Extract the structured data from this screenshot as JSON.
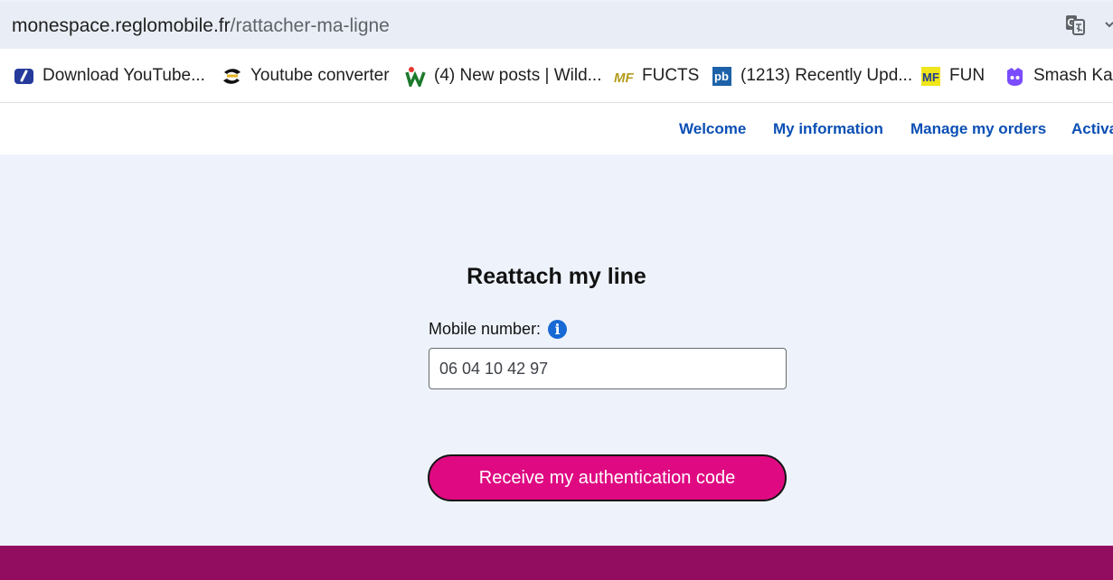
{
  "browser": {
    "url_domain": "monespace.reglomobile.fr",
    "url_path": "/rattacher-ma-ligne",
    "translate_icon": "translate-icon",
    "bookmarks": [
      {
        "label": "Download YouTube...",
        "icon": "blue-bookmark-icon",
        "color": "#2c3d9f"
      },
      {
        "label": "Youtube converter",
        "icon": "converter-bookmark-icon",
        "color": "#111111"
      },
      {
        "label": "(4) New posts | Wild...",
        "icon": "wildsubs-bookmark-icon",
        "color": "#1d7a2c"
      },
      {
        "label": "FUCTS",
        "icon": "mf-bookmark-icon",
        "color": "#b39b1d"
      },
      {
        "label": "(1213) Recently Upd...",
        "icon": "pb-bookmark-icon",
        "color": "#1d62a8"
      },
      {
        "label": "FUN",
        "icon": "mf-yellow-bookmark-icon",
        "color": "#f0e51a"
      },
      {
        "label": "Smash Kart",
        "icon": "smash-kart-bookmark-icon",
        "color": "#7b4cff"
      }
    ]
  },
  "site_nav": {
    "links": [
      "Welcome",
      "My information",
      "Manage my orders",
      "Activa"
    ]
  },
  "main": {
    "title": "Reattach my line",
    "mobile_label": "Mobile number:",
    "info_icon_label": "i",
    "mobile_value": "06 04 10 42 97",
    "button_label": "Receive my authentication code"
  },
  "colors": {
    "accent_blue": "#0b4fb5",
    "button_pink": "#df0a82",
    "footer_purple": "#920d5f"
  }
}
